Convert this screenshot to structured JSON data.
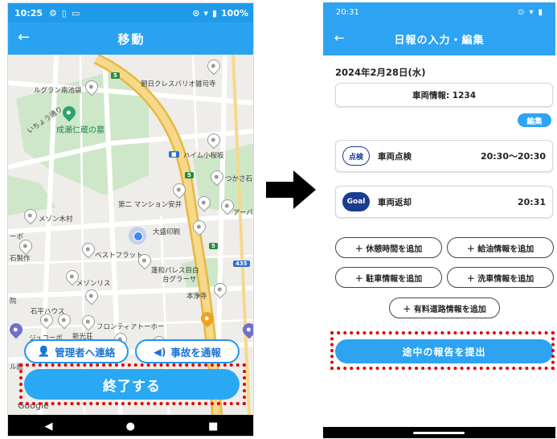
{
  "left_phone": {
    "status": {
      "time": "10:25",
      "battery": "100%"
    },
    "header": {
      "title": "移動"
    },
    "map_labels": [
      "ルグラン南池袋",
      "朝日クレスバリオ雑司寺",
      "いちょう通り",
      "成瀬仁蔵の墓",
      "ハイム小桜坂",
      "つかさ石",
      "第二 マンション安井",
      "アーバ",
      "メゾン木村",
      "大盛印刷",
      "ーボ",
      "ベストフラット",
      "石製作",
      "蓬和パレス目白",
      "台グラーサ",
      "メゾンリス",
      "本浄寺",
      "院",
      "石平ハウス",
      "フロンティアトーホー",
      "ジュコーボ",
      "新光荘",
      "ル鹿",
      "Google"
    ],
    "contact_button": "管理者へ連絡",
    "accident_button": "事故を通報",
    "end_button": "終了する"
  },
  "right_phone": {
    "status": {
      "time": "20:31"
    },
    "header": {
      "title": "日報の入力・編集"
    },
    "date": "2024年2月28日(水)",
    "vehicle_info": "車両情報: 1234",
    "edit_button": "編集",
    "tasks": [
      {
        "badge": "点検",
        "name": "車両点検",
        "time": "20:30〜20:30"
      },
      {
        "badge": "Goal",
        "name": "車両返却",
        "time": "20:31"
      }
    ],
    "add_buttons": [
      "＋ 休憩時間を追加",
      "＋ 給油情報を追加",
      "＋ 駐車情報を追加",
      "＋ 洗車情報を追加",
      "＋ 有料道路情報を追加"
    ],
    "submit_button": "途中の報告を提出"
  },
  "colors": {
    "primary_blue": "#29a3f0",
    "status_blue": "#1f9bea",
    "badge_navy": "#1a3d8f",
    "highlight_red": "#e00000",
    "road_yellow": "#f3d27a"
  },
  "icons": {
    "back": "arrow-left-icon",
    "contact": "person-icon",
    "accident": "speaker-icon",
    "nav_back": "triangle-back-icon",
    "nav_home": "circle-home-icon",
    "nav_recent": "square-recent-icon"
  }
}
